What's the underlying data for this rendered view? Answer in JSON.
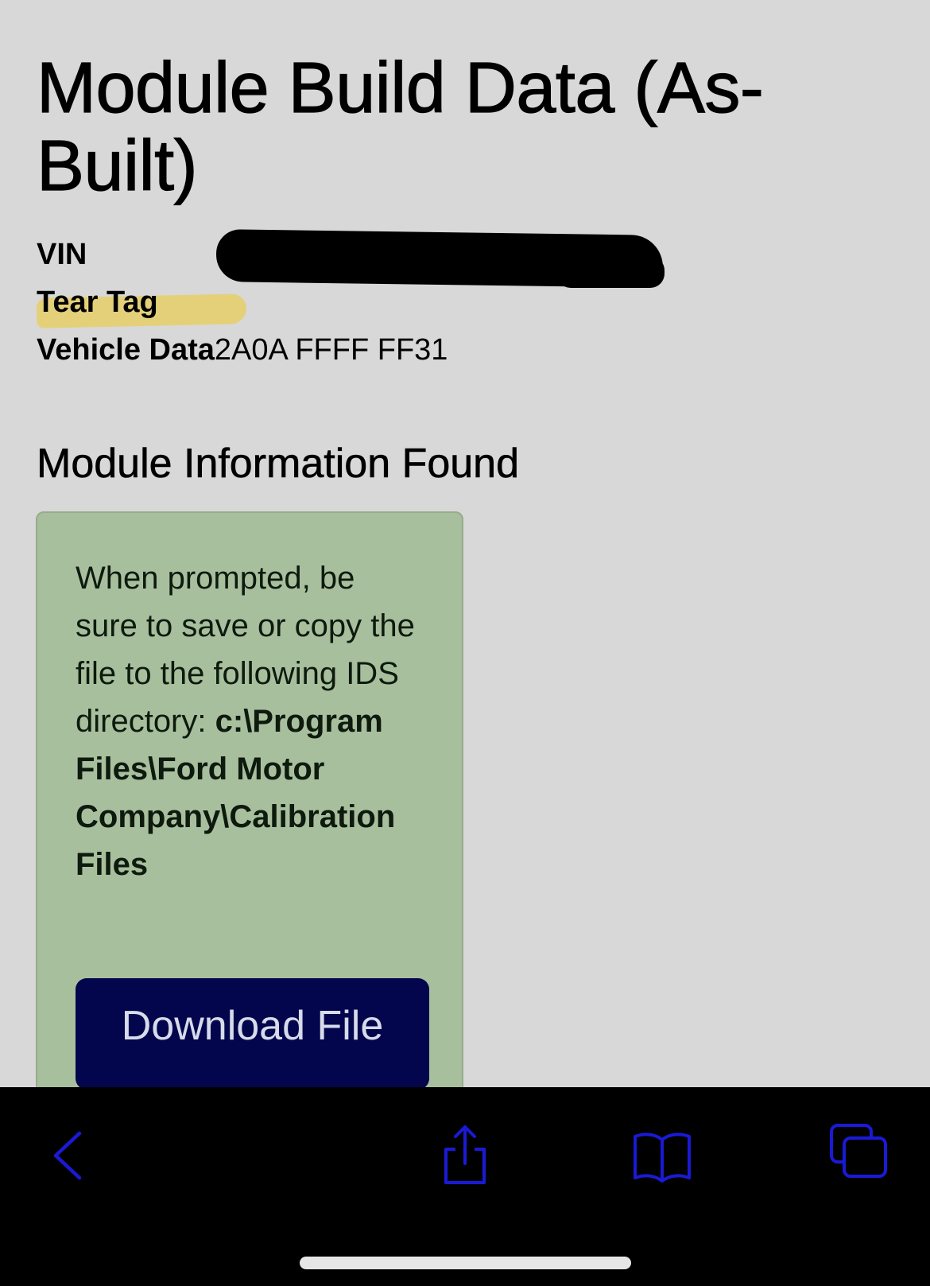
{
  "page": {
    "title": "Module Build Data (As-Built)",
    "fields": [
      {
        "label": "VIN",
        "value": ""
      },
      {
        "label": "Tear Tag",
        "value": ""
      },
      {
        "label": "Vehicle Data",
        "value": "2A0A FFFF FF31"
      }
    ],
    "section_title": "Module Information Found",
    "notice": {
      "text": "When prompted, be sure to save or copy the file to the following IDS directory:",
      "path": "c:\\Program Files\\Ford Motor Company\\Calibration Files"
    },
    "download_button": "Download File"
  },
  "browser_toolbar": {
    "icons": [
      "back-icon",
      "share-icon",
      "bookmarks-icon",
      "tabs-icon"
    ],
    "icon_color": "#1a1ad6"
  },
  "colors": {
    "background": "#d8d8d8",
    "card_background": "#a8bf9e",
    "button_background": "#03064d",
    "highlight": "#e8cf6a"
  }
}
